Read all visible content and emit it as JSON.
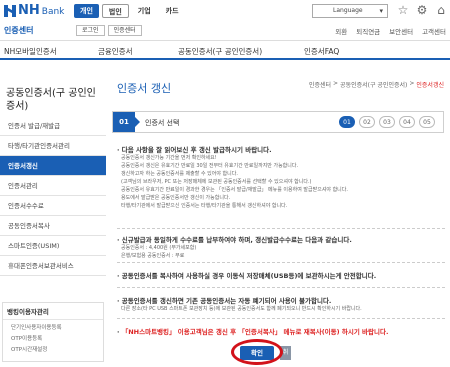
{
  "header": {
    "brand_nh": "NH",
    "brand_bank": "Bank",
    "site_name": "인증센터",
    "top_tabs": [
      "개인",
      "법인",
      "기업",
      "카드"
    ],
    "sub_buttons": [
      "로그인",
      "인증센터"
    ],
    "language": "Language",
    "icons": [
      "star-icon",
      "gear-icon",
      "home-icon"
    ],
    "top_links": [
      "외환",
      "퇴직연금",
      "보안센터",
      "고객센터"
    ],
    "accent_color": "#1a5fb4"
  },
  "menu": {
    "items": [
      "NH모바일인증서",
      "금융인증서",
      "공동인증서(구 공인인증서)",
      "인증서FAQ"
    ]
  },
  "sidebar": {
    "title": "공동인증서(구 공인인증서)",
    "items": [
      {
        "label": "인증서 발급/재발급"
      },
      {
        "label": "타행/타기관인증서관리"
      },
      {
        "label": "인증서갱신"
      },
      {
        "label": "인증서관리"
      },
      {
        "label": "인증서수수료"
      },
      {
        "label": "공동인증서복사"
      },
      {
        "label": "스마트인증(USIM)"
      },
      {
        "label": "휴대폰인증서보관서비스"
      }
    ],
    "box": {
      "title": "뱅킹이용자관리",
      "items": [
        "단기인사용자이용등록",
        "OTP이용등록",
        "OTP시간재설정"
      ]
    }
  },
  "content": {
    "page_title": "인증서 갱신",
    "breadcrumb": [
      "인증센터",
      "공동인증서(구 공인인증서)",
      "인증서갱신"
    ],
    "stepbar": {
      "current_num": "01",
      "current_label": "인증서 선택",
      "steps": [
        "01",
        "02",
        "03",
        "04",
        "05"
      ]
    },
    "notice1": {
      "head": "다음 사항을 잘 읽어보신 후 갱신 발급하시기 바랍니다.",
      "lines": [
        "공동인증서 갱신가능 기간을 먼저 확인하세요!",
        "공동인증서 갱신은 유효기간 만료일 30일 전부터 유효기간 만료일까지만 가능합니다.",
        "갱신하고자 하는 공동인증서를 제출할 수 있어야 합니다.",
        "(고객님의 브라우저, PC 또는 저장매체에 보관된 공동인증서를 선택할 수 있으셔야 합니다.)",
        "공동인증서 유효기간 만료일이 경과한 경우는 「인증서 발급/재발급」 메뉴를 이용하여 발급받으셔야 합니다.",
        "용도에서 발급받은 공동인증서만 갱신이 가능합니다.",
        "타행/타기관에서 발급받으신 인증서는 타행/타기관을 통해서 갱신하셔야 합니다."
      ]
    },
    "notice2": {
      "head": "신규발급과 동일하게 수수료를 납부하여야 하며, 갱신발급수수료는 다음과 같습니다.",
      "lines": [
        "공동인증서 : 4,400원 (부가세포함)",
        "은행/보험용 공동인증서 : 무료"
      ]
    },
    "notice3": {
      "head": "공동인증서를 복사하여 사용하실 경우 이동식 저장매체(USB등)에 보관하시는게 안전합니다."
    },
    "notice4": {
      "head": "공동인증서를 갱신하면 기존 공동인증서는 자동 폐기되어 사용이 불가합니다.",
      "lines": [
        "다른 장소(타 PC USB 스마트폰 보관장치 등)에 보관된 공동인증서도 함께 폐기되오니 반드시 확인하시기 바랍니다."
      ]
    },
    "notice5": {
      "head": "「NH스마트뱅킹」 이용고객님은 갱신 후 「인증서복사」 메뉴로 재복사(이동) 하시기 바랍니다."
    },
    "confirm_label": "확인",
    "cancel_label": "취",
    "highlight_color": "#d2121a"
  }
}
